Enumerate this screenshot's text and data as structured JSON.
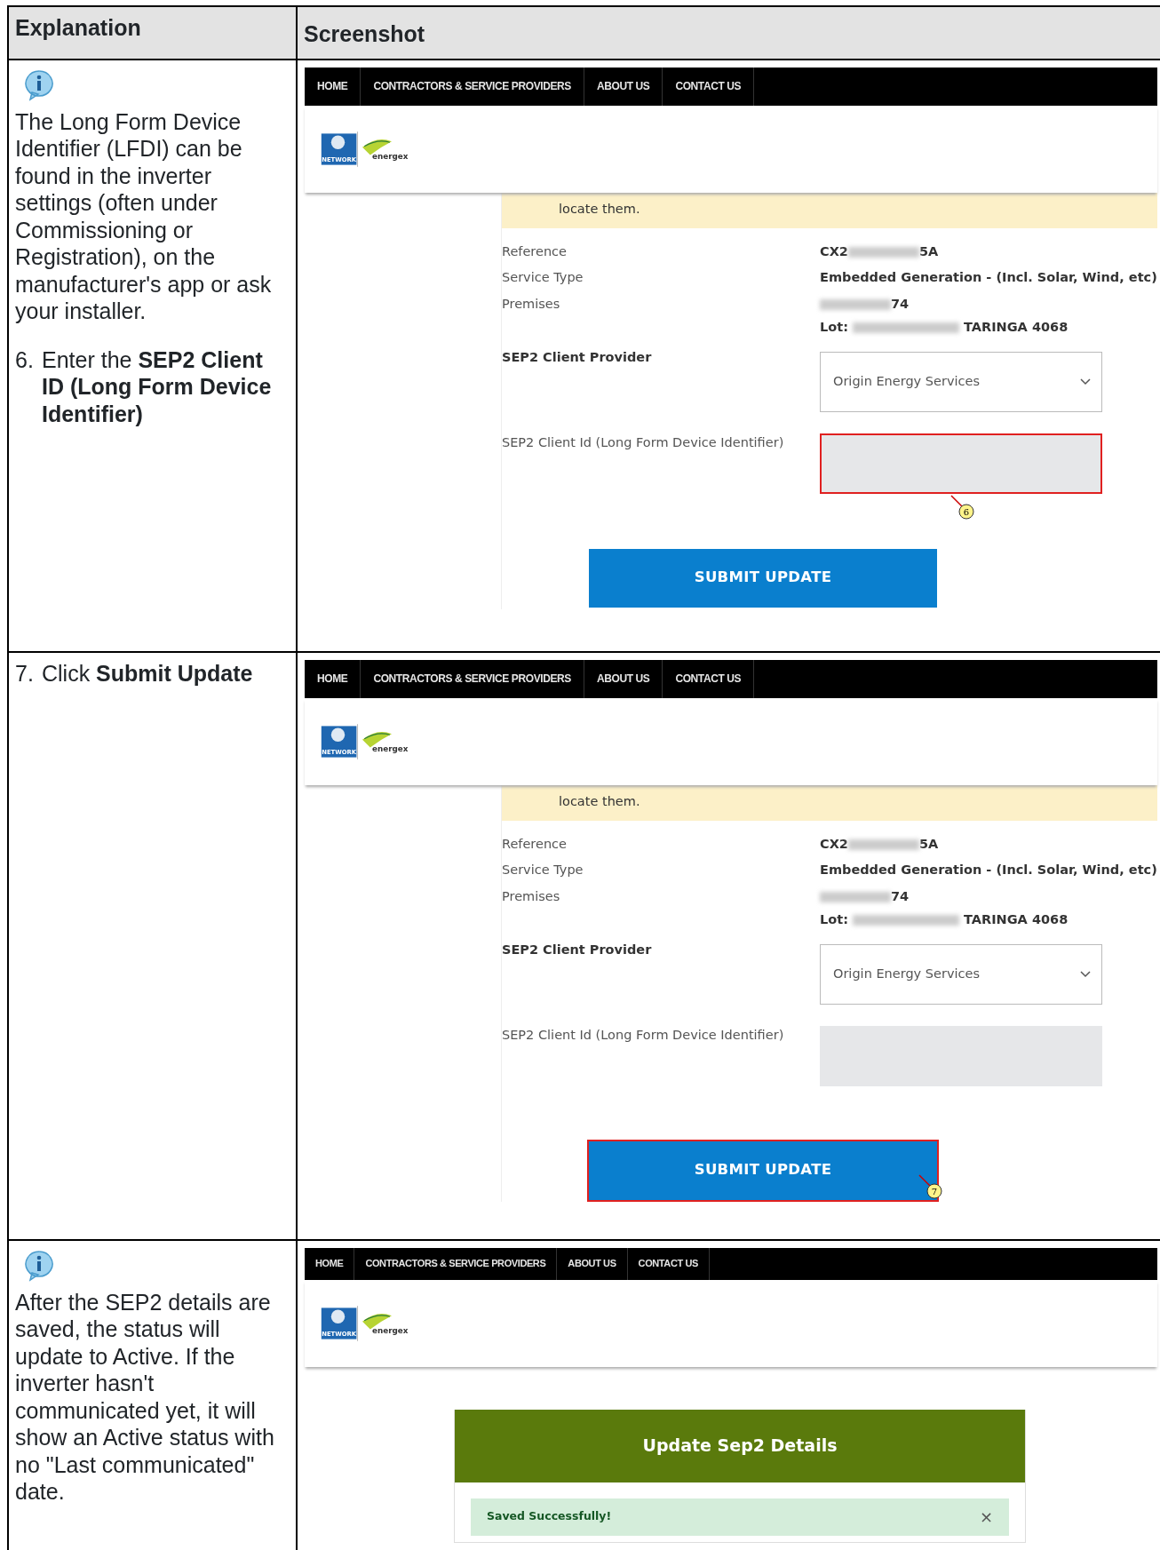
{
  "table": {
    "columns": [
      "Explanation",
      "Screenshot"
    ],
    "rows": [
      {
        "explanation": [
          {
            "kind": "info"
          },
          {
            "kind": "para",
            "text": "The Long Form Device Identifier (LFDI) can be found in the inverter settings (often under Commissioning or Registration), on the manufacturer's app or ask your installer."
          },
          {
            "kind": "step",
            "number": "6.",
            "text": "Enter the **SEP2 Client ID (Long Form Device Identifier)**"
          }
        ],
        "screenshot": {
          "kind": "form",
          "nav": [
            "HOME",
            "CONTRACTORS & SERVICE PROVIDERS",
            "ABOUT US",
            "CONTACT US"
          ],
          "logo_texts": [
            "NETWORK",
            "energex"
          ],
          "banner": "locate them.",
          "reference": {
            "label": "Reference",
            "start": "CX2",
            "end": "5A"
          },
          "service_type": {
            "label": "Service Type",
            "value": "Embedded Generation - (Incl. Solar, Wind, etc)"
          },
          "premises": {
            "label": "Premises",
            "end": "74",
            "lot_label": "Lot:",
            "lot_end": "TARINGA 4068"
          },
          "provider": {
            "label": "SEP2 Client Provider",
            "value": "Origin Energy Services"
          },
          "client_id": {
            "label": "SEP2 Client Id (Long Form Device Identifier)",
            "highlighted": true
          },
          "submit": {
            "label": "SUBMIT UPDATE",
            "highlighted": false
          },
          "callout": "6"
        }
      },
      {
        "explanation": [
          {
            "kind": "step",
            "number": "7.",
            "text": "Click **Submit Update**"
          }
        ],
        "screenshot": {
          "kind": "form",
          "nav": [
            "HOME",
            "CONTRACTORS & SERVICE PROVIDERS",
            "ABOUT US",
            "CONTACT US"
          ],
          "logo_texts": [
            "NETWORK",
            "energex"
          ],
          "banner": "locate them.",
          "reference": {
            "label": "Reference",
            "start": "CX2",
            "end": "5A"
          },
          "service_type": {
            "label": "Service Type",
            "value": "Embedded Generation - (Incl. Solar, Wind, etc)"
          },
          "premises": {
            "label": "Premises",
            "end": "74",
            "lot_label": "Lot:",
            "lot_end": "TARINGA 4068"
          },
          "provider": {
            "label": "SEP2 Client Provider",
            "value": "Origin Energy Services"
          },
          "client_id": {
            "label": "SEP2 Client Id (Long Form Device Identifier)",
            "highlighted": false
          },
          "submit": {
            "label": "SUBMIT UPDATE",
            "highlighted": true
          },
          "callout": "7"
        }
      },
      {
        "explanation": [
          {
            "kind": "info"
          },
          {
            "kind": "para",
            "text": "After the SEP2 details are saved, the status will update to Active. If the inverter hasn't communicated yet, it will show an Active status with no \"Last communicated\" date."
          }
        ],
        "screenshot": {
          "kind": "saved",
          "nav": [
            "HOME",
            "CONTRACTORS & SERVICE PROVIDERS",
            "ABOUT US",
            "CONTACT US"
          ],
          "logo_texts": [
            "NETWORK",
            "energex"
          ],
          "panel_title": "Update Sep2 Details",
          "alert": "Saved Successfully!",
          "alert_close": "×"
        }
      }
    ]
  }
}
